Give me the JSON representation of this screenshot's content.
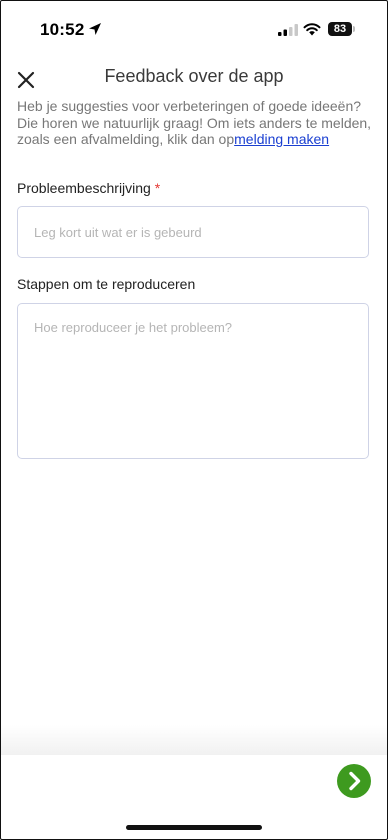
{
  "status_bar": {
    "time": "10:52",
    "battery": "83",
    "icons": [
      "location-arrow-icon",
      "cellular-signal-icon",
      "wifi-icon",
      "battery-icon"
    ]
  },
  "header": {
    "title": "Feedback over de app",
    "close_icon": "close-icon"
  },
  "intro": {
    "text": "Heb je suggesties voor verbeteringen of goede ideeën? Die horen we natuurlijk graag! Om iets anders te melden, zoals een afvalmelding, klik dan op",
    "link_text": "melding maken",
    "link_color": "#1a3fd1"
  },
  "form": {
    "problem": {
      "label": "Probleembeschrijving",
      "required_marker": "*",
      "placeholder": "Leg kort uit wat er is gebeurd",
      "value": ""
    },
    "steps": {
      "label": "Stappen om te reproduceren",
      "placeholder": "Hoe reproduceer je het probleem?",
      "value": ""
    }
  },
  "footer": {
    "next_icon": "chevron-right-icon",
    "accent_color": "#3e9a1f"
  }
}
